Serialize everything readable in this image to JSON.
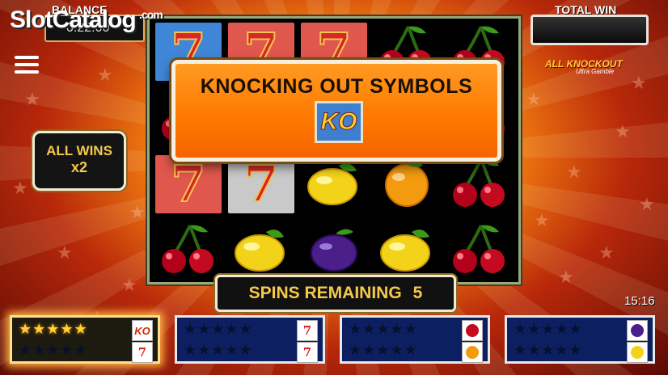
{
  "header": {
    "balance_label": "BALANCE",
    "balance_value": "0.22.00",
    "total_win_label": "TOTAL WIN",
    "watermark_text": "SlotCatalog",
    "watermark_suffix": ".com"
  },
  "game_logo": {
    "title": "ALL KNOCKOUT",
    "subtitle": "Ultra Gamble"
  },
  "multiplier": {
    "line1": "ALL WINS",
    "line2": "x2"
  },
  "popup": {
    "title": "KNOCKING OUT SYMBOLS",
    "badge": "KO"
  },
  "spins": {
    "label": "SPINS REMAINING",
    "count": "5"
  },
  "clock": "15:16",
  "reels": [
    [
      "seven-blue",
      "cherries",
      "seven-red",
      "cherries"
    ],
    [
      "seven-red",
      "cherries",
      "seven-silver",
      "lemon"
    ],
    [
      "seven-red",
      "blank",
      "lemon",
      "plum"
    ],
    [
      "cherries",
      "blank",
      "orange",
      "lemon"
    ],
    [
      "cherries",
      "cherries",
      "cherries",
      "cherries"
    ]
  ],
  "panels": [
    {
      "stars_lit": 5,
      "stars_total": 5,
      "symbols": [
        "KO",
        "7"
      ]
    },
    {
      "stars_lit": 0,
      "stars_total": 5,
      "symbols": [
        "7",
        "7"
      ]
    },
    {
      "stars_lit": 0,
      "stars_total": 5,
      "symbols": [
        "cherries",
        "orange"
      ]
    },
    {
      "stars_lit": 0,
      "stars_total": 5,
      "symbols": [
        "plum",
        "lemon"
      ]
    }
  ],
  "colors": {
    "popup": "#ff7a00",
    "accent_gold": "#f5c94a",
    "panel_blue": "#0c1f60"
  }
}
